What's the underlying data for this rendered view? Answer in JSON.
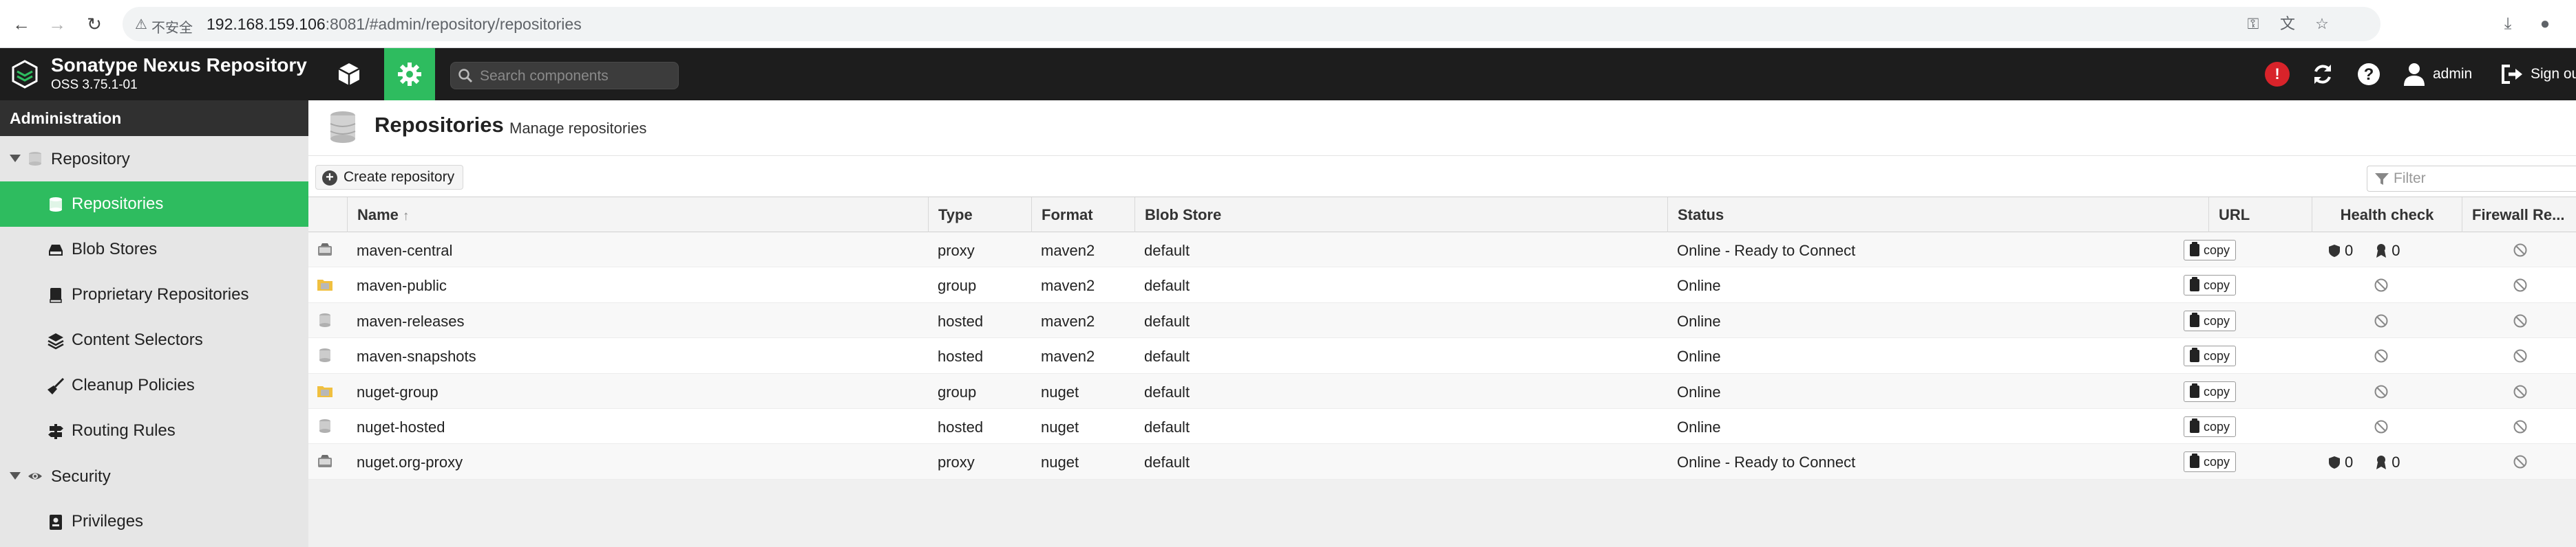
{
  "browser": {
    "insecure_label": "不安全",
    "url_host": "192.168.159.106",
    "url_path": ":8081/#admin/repository/repositories"
  },
  "header": {
    "brand_name": "Sonatype Nexus Repository",
    "brand_version": "OSS 3.75.1-01",
    "search_placeholder": "Search components",
    "alert_badge": "!",
    "user_label": "admin",
    "signout_label": "Sign ou"
  },
  "sidebar": {
    "title": "Administration",
    "groups": [
      {
        "label": "Repository"
      },
      {
        "label": "Security"
      }
    ],
    "items": [
      {
        "label": "Repositories"
      },
      {
        "label": "Blob Stores"
      },
      {
        "label": "Proprietary Repositories"
      },
      {
        "label": "Content Selectors"
      },
      {
        "label": "Cleanup Policies"
      },
      {
        "label": "Routing Rules"
      },
      {
        "label": "Privileges"
      }
    ]
  },
  "page": {
    "title": "Repositories",
    "subtitle": "Manage repositories",
    "create_label": "Create repository",
    "filter_placeholder": "Filter"
  },
  "grid": {
    "columns": {
      "name": "Name",
      "name_sort": "↑",
      "type": "Type",
      "format": "Format",
      "blob": "Blob Store",
      "status": "Status",
      "url": "URL",
      "health": "Health check",
      "firewall": "Firewall Re..."
    },
    "copy_label": "copy",
    "rows": [
      {
        "name": "maven-central",
        "type": "proxy",
        "format": "maven2",
        "blob": "default",
        "status": "Online - Ready to Connect",
        "health_a": "0",
        "health_b": "0"
      },
      {
        "name": "maven-public",
        "type": "group",
        "format": "maven2",
        "blob": "default",
        "status": "Online"
      },
      {
        "name": "maven-releases",
        "type": "hosted",
        "format": "maven2",
        "blob": "default",
        "status": "Online"
      },
      {
        "name": "maven-snapshots",
        "type": "hosted",
        "format": "maven2",
        "blob": "default",
        "status": "Online"
      },
      {
        "name": "nuget-group",
        "type": "group",
        "format": "nuget",
        "blob": "default",
        "status": "Online"
      },
      {
        "name": "nuget-hosted",
        "type": "hosted",
        "format": "nuget",
        "blob": "default",
        "status": "Online"
      },
      {
        "name": "nuget.org-proxy",
        "type": "proxy",
        "format": "nuget",
        "blob": "default",
        "status": "Online - Ready to Connect",
        "health_a": "0",
        "health_b": "0"
      }
    ]
  }
}
